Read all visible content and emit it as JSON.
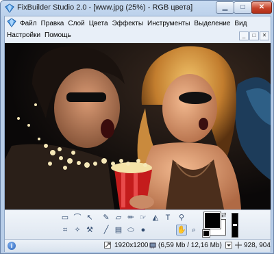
{
  "window": {
    "title": "FixBuilder Studio 2.0 - [www.jpg (25%) - RGB цвета]",
    "minimize_glyph": "▁",
    "maximize_glyph": "□",
    "close_glyph": "✕"
  },
  "menu": {
    "row1": [
      "Файл",
      "Правка",
      "Слой",
      "Цвета",
      "Эффекты",
      "Инструменты",
      "Выделение",
      "Вид"
    ],
    "row2": [
      "Настройки",
      "Помощь"
    ],
    "mdi_buttons": [
      "_",
      "□",
      "✕"
    ]
  },
  "tools": [
    {
      "name": "rect-select-icon",
      "glyph": "▭"
    },
    {
      "name": "lasso-icon",
      "glyph": "⌒"
    },
    {
      "name": "move-icon",
      "glyph": "↖"
    },
    {
      "name": "crop-icon",
      "glyph": "⌗"
    },
    {
      "name": "brush-icon",
      "glyph": "✎"
    },
    {
      "name": "eraser-icon",
      "glyph": "▱"
    },
    {
      "name": "fill-bucket-icon",
      "glyph": "◭"
    },
    {
      "name": "text-tool-icon",
      "glyph": "T"
    },
    {
      "name": "eyedropper-icon",
      "glyph": "⚲"
    },
    {
      "name": "pencil-icon",
      "glyph": "✏"
    },
    {
      "name": "magic-wand-icon",
      "glyph": "✧"
    },
    {
      "name": "clone-stamp-icon",
      "glyph": "⚒"
    },
    {
      "name": "smudge-icon",
      "glyph": "☞"
    },
    {
      "name": "line-tool-icon",
      "glyph": "╱"
    },
    {
      "name": "gradient-icon",
      "glyph": "▤"
    },
    {
      "name": "shape-tool-icon",
      "glyph": "⬭"
    },
    {
      "name": "ellipse-tool-icon",
      "glyph": "●"
    },
    {
      "name": "hand-tool-icon",
      "glyph": "✋"
    },
    {
      "name": "zoom-tool-icon",
      "glyph": "⌕"
    }
  ],
  "colors": {
    "foreground": "#000000",
    "background": "#ffffff",
    "swap_glyph": "⇄"
  },
  "status": {
    "info_glyph": "i",
    "dimensions": "1920x1200",
    "memory": "(6,59 Mb / 12,16 Mb)",
    "cursor": "928, 904"
  }
}
